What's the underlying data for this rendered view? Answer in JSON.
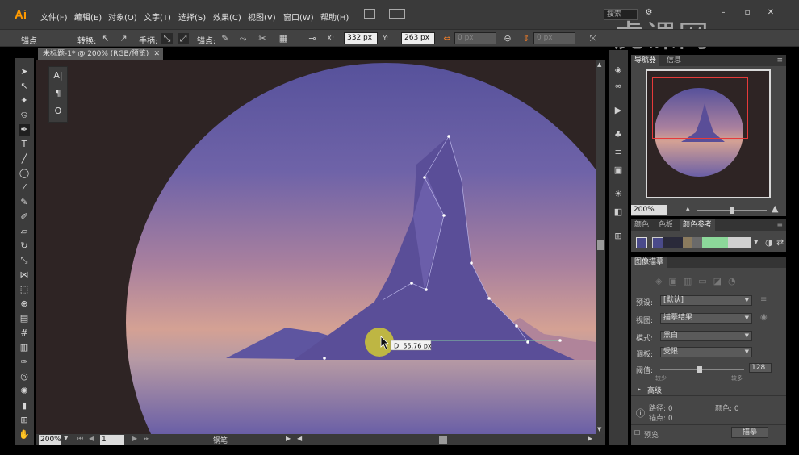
{
  "app": {
    "logo": "Ai"
  },
  "menu": [
    "文件(F)",
    "编辑(E)",
    "对象(O)",
    "文字(T)",
    "选择(S)",
    "效果(C)",
    "视图(V)",
    "窗口(W)",
    "帮助(H)"
  ],
  "search_placeholder": "搜索",
  "control_bar": {
    "tool_label": "锚点",
    "convert_label": "转换:",
    "handles_label": "手柄:",
    "anchor_label": "锚点:",
    "x_label": "X:",
    "x_value": "332 px",
    "y_label": "Y:",
    "y_value": "263 px",
    "w_value": "0 px",
    "h_value": "0 px"
  },
  "watermark": "虎课网",
  "document_tab": "未标题-1* @ 200% (RGB/预览)",
  "measure_tooltip": "D: 55.76 px",
  "status_bar": {
    "zoom": "200%",
    "artboard": "1",
    "tool_name": "钢笔"
  },
  "navigator": {
    "tabs": [
      "导航器",
      "信息"
    ],
    "zoom": "200%"
  },
  "color_panel": {
    "tabs": [
      "颜色",
      "色板",
      "颜色参考"
    ]
  },
  "swatches": [
    "#4a4a8a",
    "#2a2a3a",
    "#8a7a5e",
    "#6a6a6a",
    "#8cd89a",
    "#d0d0d0"
  ],
  "image_trace": {
    "title": "图像描摹",
    "preset_label": "预设:",
    "preset_value": "[默认]",
    "view_label": "视图:",
    "view_value": "描摹结果",
    "mode_label": "模式:",
    "mode_value": "黑白",
    "palette_label": "调板:",
    "palette_value": "受限",
    "threshold_label": "阈值:",
    "threshold_value": "128",
    "threshold_min": "较少",
    "threshold_max": "较多",
    "advanced_label": "高级",
    "paths_label": "路径: 0",
    "colors_label": "颜色: 0",
    "anchors_label": "锚点: 0",
    "preview_label": "预览",
    "trace_button": "描摹"
  },
  "colors": {
    "accent": "#ff9a00",
    "sky_top": "#5a54a0",
    "mountain": "#5b4e9a",
    "nav_red": "#e63a3a"
  }
}
